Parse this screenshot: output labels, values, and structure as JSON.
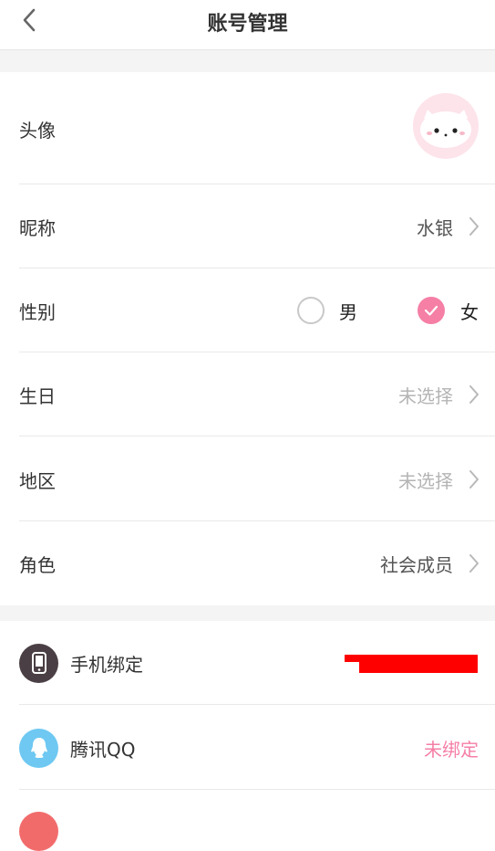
{
  "header": {
    "title": "账号管理",
    "back_icon": "chevron-left-icon"
  },
  "profile": {
    "avatar": {
      "label": "头像"
    },
    "nickname": {
      "label": "昵称",
      "value": "水银"
    },
    "gender": {
      "label": "性别",
      "options": [
        "男",
        "女"
      ],
      "selected": "女"
    },
    "birthday": {
      "label": "生日",
      "value": "未选择"
    },
    "region": {
      "label": "地区",
      "value": "未选择"
    },
    "role": {
      "label": "角色",
      "value": "社会成员"
    }
  },
  "bindings": {
    "phone": {
      "label": "手机绑定",
      "value": "",
      "icon": "phone-icon"
    },
    "qq": {
      "label": "腾讯QQ",
      "value": "未绑定",
      "icon": "qq-icon"
    }
  },
  "colors": {
    "accent": "#f57fa5",
    "separator": "#e9e9e9",
    "gap": "#f4f4f4",
    "muted": "#b4b4b4",
    "phone_icon_bg": "#4a3f44",
    "qq_icon_bg": "#6ec8f2"
  }
}
